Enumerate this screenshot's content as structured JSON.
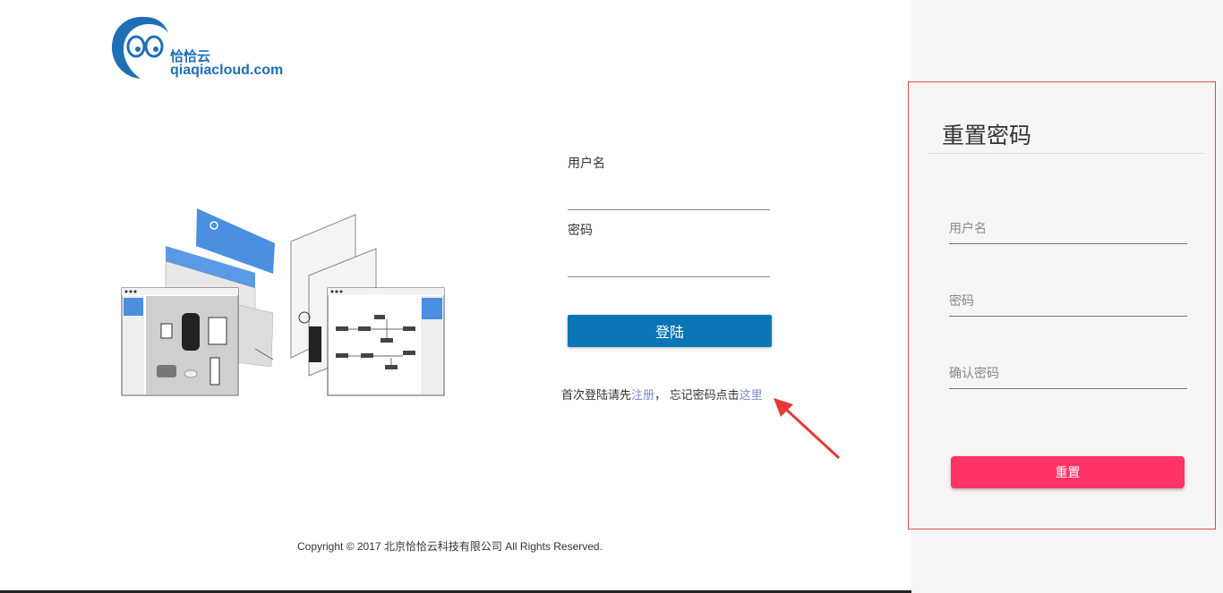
{
  "logo": {
    "cn_text": "恰恰云",
    "en_text": "qiaqiacloud.com"
  },
  "login": {
    "username_label": "用户名",
    "password_label": "密码",
    "submit_label": "登陆",
    "hint_prefix": "首次登陆请先",
    "register_link": "注册",
    "hint_middle": "，  忘记密码点击",
    "forgot_link": "这里"
  },
  "footer": {
    "copyright": "Copyright © 2017 北京恰恰云科技有限公司 All Rights Reserved."
  },
  "reset": {
    "title": "重置密码",
    "username_placeholder": "用户名",
    "password_placeholder": "密码",
    "confirm_placeholder": "确认密码",
    "submit_label": "重置"
  },
  "colors": {
    "primary": "#0a76b6",
    "reset_button": "#ff3366",
    "panel_border": "#e04a4a",
    "link": "#7b8ccf",
    "annotation_arrow": "#e53935"
  }
}
